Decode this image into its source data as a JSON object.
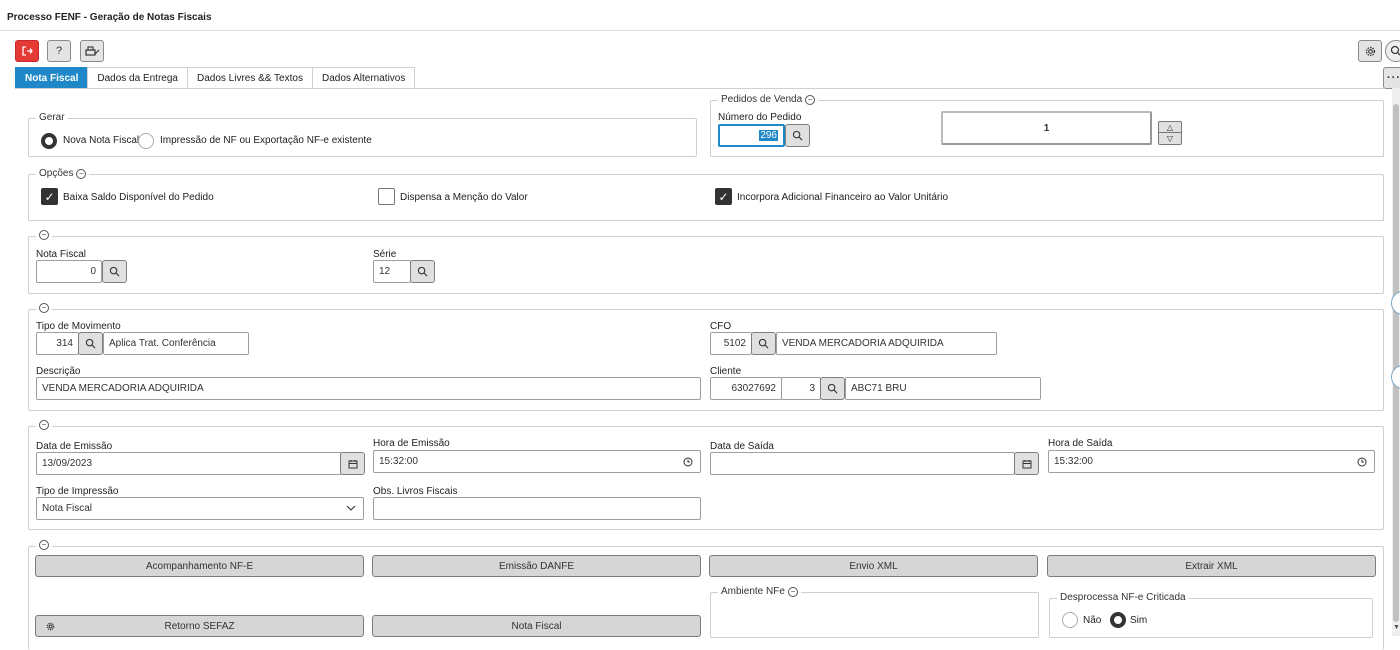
{
  "window": {
    "title": "Processo FENF - Geração de Notas Fiscais"
  },
  "toolbar": {
    "exit_icon": "exit-icon",
    "help_label": "?",
    "print_icon": "print-icon"
  },
  "tabs": [
    {
      "label": "Nota Fiscal",
      "active": true
    },
    {
      "label": "Dados da Entrega"
    },
    {
      "label": "Dados Livres && Textos"
    },
    {
      "label": "Dados Alternativos"
    }
  ],
  "gerar": {
    "legend": "Gerar",
    "option_nova": "Nova Nota Fiscal",
    "option_impressao": "Impressão de NF ou Exportação NF-e existente",
    "selected": "nova"
  },
  "pedidos": {
    "legend": "Pedidos de Venda",
    "numero_label": "Número do Pedido",
    "numero_value": "296",
    "count_value": "1"
  },
  "opcoes": {
    "legend": "Opções",
    "baixa_label": "Baixa Saldo Disponível do Pedido",
    "baixa_checked": true,
    "dispensa_label": "Dispensa a Menção do Valor",
    "dispensa_checked": false,
    "incorpora_label": "Incorpora Adicional Financeiro ao Valor Unitário",
    "incorpora_checked": true
  },
  "nota": {
    "nf_label": "Nota Fiscal",
    "nf_value": "0",
    "serie_label": "Série",
    "serie_value": "12"
  },
  "movimento": {
    "tipo_label": "Tipo de Movimento",
    "tipo_code": "314",
    "tipo_desc": "Aplica Trat. Conferência",
    "cfo_label": "CFO",
    "cfo_code": "5102",
    "cfo_desc": "VENDA MERCADORIA ADQUIRIDA",
    "descricao_label": "Descrição",
    "descricao_value": "VENDA MERCADORIA ADQUIRIDA",
    "cliente_label": "Cliente",
    "cliente_code": "63027692",
    "cliente_seq": "3",
    "cliente_nome": "ABC71 BRU"
  },
  "datas": {
    "emissao_label": "Data de Emissão",
    "emissao_value": "13/09/2023",
    "hora_emissao_label": "Hora de Emissão",
    "hora_emissao_value": "15:32:00",
    "saida_label": "Data de Saída",
    "saida_value": "",
    "hora_saida_label": "Hora de Saída",
    "hora_saida_value": "15:32:00",
    "tipo_impressao_label": "Tipo de Impressão",
    "tipo_impressao_value": "Nota Fiscal",
    "obs_label": "Obs. Livros Fiscais",
    "obs_value": ""
  },
  "acoes": {
    "acompanhamento": "Acompanhamento NF-E",
    "emissao_danfe": "Emissão DANFE",
    "envio_xml": "Envio XML",
    "extrair_xml": "Extrair XML",
    "retorno_sefaz": "Retorno SEFAZ",
    "nota_fiscal": "Nota Fiscal",
    "ambiente_legend": "Ambiente NFe",
    "desprocessa_legend": "Desprocessa NF-e Criticada",
    "desprocessa_nao": "Não",
    "desprocessa_sim": "Sim",
    "desprocessa_selected": "sim"
  },
  "colors": {
    "accent": "#1e88c8",
    "danger": "#e53935"
  }
}
